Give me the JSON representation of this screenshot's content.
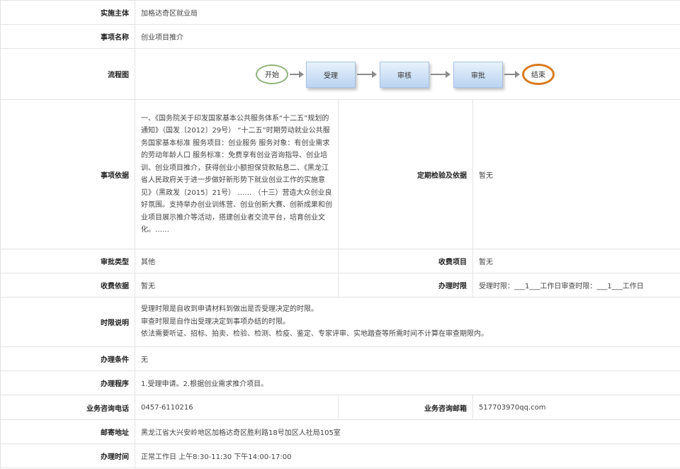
{
  "rows": {
    "implementer": {
      "label": "实施主体",
      "value": "加格达奇区就业局"
    },
    "item_name": {
      "label": "事项名称",
      "value": "创业项目推介"
    },
    "flowchart": {
      "label": "流程图",
      "nodes": {
        "start": "开始",
        "accept": "受理",
        "review": "审核",
        "approve": "审批",
        "end": "结束"
      }
    },
    "basis": {
      "label": "事项依据",
      "value": "一、《国务院关于印发国家基本公共服务体系“十二五”规划的通知》（国发〔2012〕29号） “十二五”时期劳动就业公共服务国家基本标准 服务项目：创业服务 服务对象：有创业需求的劳动年龄人口 服务标准：免费享有创业咨询指导、创业培训、创业项目推介，获得创业小额担保贷款贴息二、《黑龙江省人民政府关于进一步做好新形势下就业创业工作的实施意见》（黑政发〔2015〕21号） …… （十三）营造大众创业良好氛围。支持举办创业训练营、创业创新大赛、创新成果和创业项目展示推介等活动，搭建创业者交流平台，培育创业文化。……",
      "inspection_label": "定期检验及依据",
      "inspection_value": "暂无"
    },
    "approval_type": {
      "label": "审批类型",
      "value": "其他",
      "fee_items_label": "收费项目",
      "fee_items_value": "暂无"
    },
    "fee_basis": {
      "label": "收费依据",
      "value": "暂无",
      "time_limit_label": "办理时限",
      "time_limit_value": "受理时限：___1___工作日审查时限：___1___工作日"
    },
    "time_desc": {
      "label": "时限说明",
      "lines": [
        "受理时限是自收到申请材料到做出是否受理决定的时限。",
        "审查时限是自作出受理决定到事项办结的时限。",
        "依法需要听证、招标、拍卖、检验、检测、检疫、鉴定、专家评审、实地踏查等所需时间不计算在审查期限内。"
      ]
    },
    "conditions": {
      "label": "办理条件",
      "value": "无"
    },
    "procedure": {
      "label": "办理程序",
      "value": "1.受理申请。2.根据创业需求推介项目。"
    },
    "phone": {
      "label": "业务咨询电话",
      "value": "0457-6110216",
      "email_label": "业务咨询邮箱",
      "email_value": "517703970qq.com"
    },
    "address": {
      "label": "邮寄地址",
      "value": "黑龙江省大兴安岭地区加格达奇区胜利路18号加区人社局105室"
    },
    "hours": {
      "label": "办理时间",
      "value": "正常工作日 上午8:30-11:30 下午14:00-17:00"
    }
  }
}
